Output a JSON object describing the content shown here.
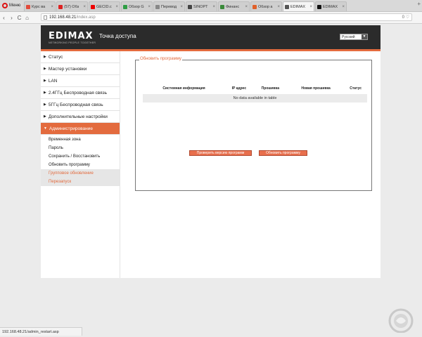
{
  "browser": {
    "menu_label": "Меню",
    "tabs": [
      {
        "title": "Курс ва",
        "color": "#e24b3b",
        "active": false
      },
      {
        "title": "(57) Обз",
        "color": "#d22",
        "active": false
      },
      {
        "title": "GECID.c",
        "color": "#e00",
        "active": false
      },
      {
        "title": "Обзор G",
        "color": "#2f9e44",
        "active": false
      },
      {
        "title": "Перевод",
        "color": "#888",
        "active": false
      },
      {
        "title": "SINOPT",
        "color": "#444",
        "active": false
      },
      {
        "title": "Финанс",
        "color": "#3a8a3a",
        "active": false
      },
      {
        "title": "Обзор а",
        "color": "#e0602a",
        "active": false
      },
      {
        "title": "EDIMAX",
        "color": "#555",
        "active": true
      },
      {
        "title": "EDIMAX",
        "color": "#111",
        "active": false
      }
    ],
    "add_tab": "+",
    "nav": {
      "back": "‹",
      "forward": "›",
      "reload": "C",
      "home": "⌂"
    },
    "url_host": "192.168.48.21",
    "url_path": "/index.asp",
    "url_right": "0 ♡",
    "status_url": "192.168.48.21/admin_restart.asp"
  },
  "router": {
    "logo": "EDIMAX",
    "logo_tagline": "NETWORKING PEOPLE TOGETHER",
    "header_title": "Точка доступа",
    "language": "Русский",
    "sidebar": {
      "items": [
        {
          "label": "Статус"
        },
        {
          "label": "Мастер установки"
        },
        {
          "label": "LAN"
        },
        {
          "label": "2.4ГГц Беспроводная связь"
        },
        {
          "label": "5ГГц Беспроводная связь"
        },
        {
          "label": "Дополнительные настройки"
        },
        {
          "label": "Администрирование"
        }
      ],
      "submenu": [
        {
          "label": "Временная зона"
        },
        {
          "label": "Пароль"
        },
        {
          "label": "Сохранить / Восстановить"
        },
        {
          "label": "Обновить программу"
        },
        {
          "label": "Групповое обновление"
        },
        {
          "label": "Перезапуск"
        }
      ]
    },
    "panel": {
      "legend": "Обновить программу",
      "columns": [
        "Системная информация",
        "IP адрес",
        "Прошивка",
        "Новая прошивка",
        "Статус"
      ],
      "empty_text": "No data available in table",
      "check_button": "Проверить версию программ",
      "update_button": "Обновить программу"
    }
  }
}
